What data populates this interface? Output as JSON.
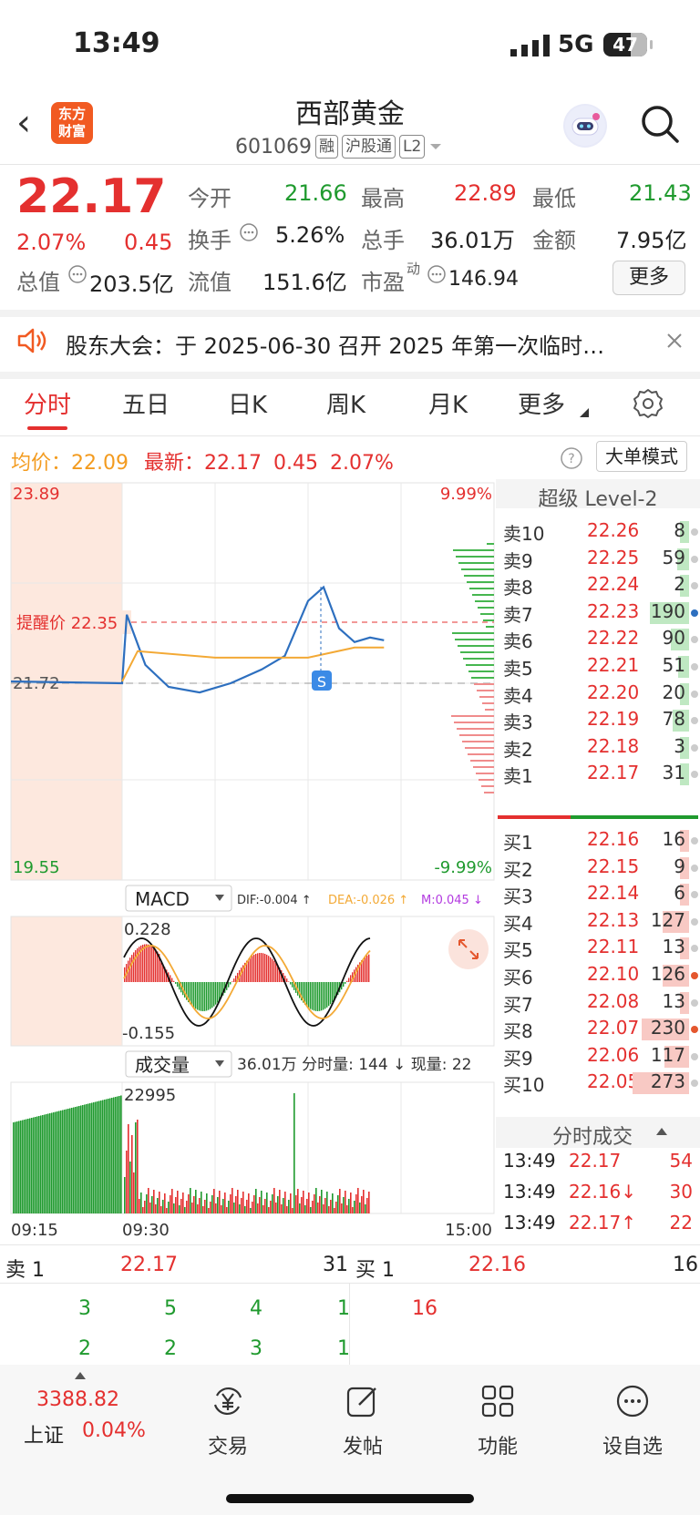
{
  "status": {
    "time": "13:49",
    "network": "5G",
    "battery": "47"
  },
  "header": {
    "title": "西部黄金",
    "code": "601069",
    "tags": [
      "融",
      "沪股通",
      "L2"
    ],
    "logo": [
      "东方",
      "财富"
    ]
  },
  "quote": {
    "price": "22.17",
    "pct": "2.07%",
    "chg": "0.45",
    "open_label": "今开",
    "open": "21.66",
    "high_label": "最高",
    "high": "22.89",
    "low_label": "最低",
    "low": "21.43",
    "turnover_label": "换手",
    "turnover": "5.26%",
    "volume_label": "总手",
    "volume": "36.01万",
    "amount_label": "金额",
    "amount": "7.95亿",
    "mcap_label": "总值",
    "mcap": "203.5亿",
    "float_label": "流值",
    "float": "151.6亿",
    "pe_label": "市盈",
    "pe_sup": "动",
    "pe": "146.94",
    "more": "更多"
  },
  "notice": {
    "text": "股东大会：于 2025-06-30 召开 2025 年第一次临时…"
  },
  "tabs": [
    "分时",
    "五日",
    "日K",
    "周K",
    "月K",
    "更多"
  ],
  "info": {
    "avg_label": "均价：",
    "avg": "22.09",
    "last_label": "最新：",
    "last": "22.17",
    "chg": "0.45",
    "pct": "2.07%",
    "bigmode": "大单模式"
  },
  "chart": {
    "y_top": "23.89",
    "y_bottom": "19.55",
    "pct_top": "9.99%",
    "pct_bottom": "-9.99%",
    "ref": "21.72",
    "alert": "提醒价 22.35",
    "marker": "S",
    "macd_sel": "MACD",
    "dif": "DIF:-0.004 ↑",
    "dea": "DEA:-0.026 ↑",
    "m": "M:0.045 ↓",
    "macd_top": "0.228",
    "macd_bottom": "-0.155",
    "vol_sel": "成交量",
    "vol_info": "36.01万 分时量: 144 ↓ 现量: 22",
    "vol_max": "22995",
    "t_start": "09:15",
    "t_open": "09:30",
    "t_end": "15:00"
  },
  "chart_data": {
    "type": "line",
    "title": "",
    "series": [
      {
        "name": "",
        "x": [
          "09:15",
          "09:30",
          "09:33",
          "09:45",
          "10:00",
          "10:20",
          "10:40",
          "11:00",
          "11:15",
          "11:30",
          "13:10",
          "13:20",
          "13:30",
          "13:40",
          "13:49"
        ],
        "values": [
          21.72,
          21.7,
          22.45,
          21.9,
          21.66,
          21.6,
          21.7,
          21.85,
          22.0,
          22.6,
          22.75,
          22.3,
          22.15,
          22.2,
          22.17
        ]
      },
      {
        "name": "均价",
        "x": [
          "09:30",
          "09:40",
          "10:30",
          "11:30",
          "13:30",
          "13:49"
        ],
        "values": [
          21.72,
          22.05,
          21.98,
          21.98,
          22.09,
          22.09
        ]
      }
    ],
    "ylim": [
      19.55,
      23.89
    ],
    "reference": 21.72,
    "alert_price": 22.35
  },
  "orderbook": {
    "title": "超级 Level-2",
    "asks": [
      {
        "label": "卖10",
        "price": "22.26",
        "vol": "8"
      },
      {
        "label": "卖9",
        "price": "22.25",
        "vol": "59"
      },
      {
        "label": "卖8",
        "price": "22.24",
        "vol": "2"
      },
      {
        "label": "卖7",
        "price": "22.23",
        "vol": "190"
      },
      {
        "label": "卖6",
        "price": "22.22",
        "vol": "90"
      },
      {
        "label": "卖5",
        "price": "22.21",
        "vol": "51"
      },
      {
        "label": "卖4",
        "price": "22.20",
        "vol": "20"
      },
      {
        "label": "卖3",
        "price": "22.19",
        "vol": "78"
      },
      {
        "label": "卖2",
        "price": "22.18",
        "vol": "3"
      },
      {
        "label": "卖1",
        "price": "22.17",
        "vol": "31"
      }
    ],
    "bids": [
      {
        "label": "买1",
        "price": "22.16",
        "vol": "16"
      },
      {
        "label": "买2",
        "price": "22.15",
        "vol": "9"
      },
      {
        "label": "买3",
        "price": "22.14",
        "vol": "6"
      },
      {
        "label": "买4",
        "price": "22.13",
        "vol": "127"
      },
      {
        "label": "买5",
        "price": "22.11",
        "vol": "13"
      },
      {
        "label": "买6",
        "price": "22.10",
        "vol": "126"
      },
      {
        "label": "买7",
        "price": "22.08",
        "vol": "13"
      },
      {
        "label": "买8",
        "price": "22.07",
        "vol": "230"
      },
      {
        "label": "买9",
        "price": "22.06",
        "vol": "117"
      },
      {
        "label": "买10",
        "price": "22.05",
        "vol": "273"
      }
    ],
    "trades_title": "分时成交",
    "trades": [
      {
        "time": "13:49",
        "price": "22.17",
        "vol": "54"
      },
      {
        "time": "13:49",
        "price": "22.16↓",
        "vol": "30"
      },
      {
        "time": "13:49",
        "price": "22.17↑",
        "vol": "22"
      }
    ]
  },
  "bottom": {
    "ask_label": "卖 1",
    "ask_price": "22.17",
    "ask_vol": "31",
    "bid_label": "买 1",
    "bid_price": "22.16",
    "bid_vol": "16",
    "ask_queue_1": [
      "3",
      "5",
      "4",
      "1"
    ],
    "ask_queue_2": [
      "2",
      "2",
      "3",
      "1"
    ],
    "bid_queue": [
      "16"
    ]
  },
  "footer": {
    "index_value": "3388.82",
    "index_name": "上证",
    "index_pct": "0.04%",
    "items": [
      "交易",
      "发帖",
      "功能",
      "设自选"
    ]
  }
}
